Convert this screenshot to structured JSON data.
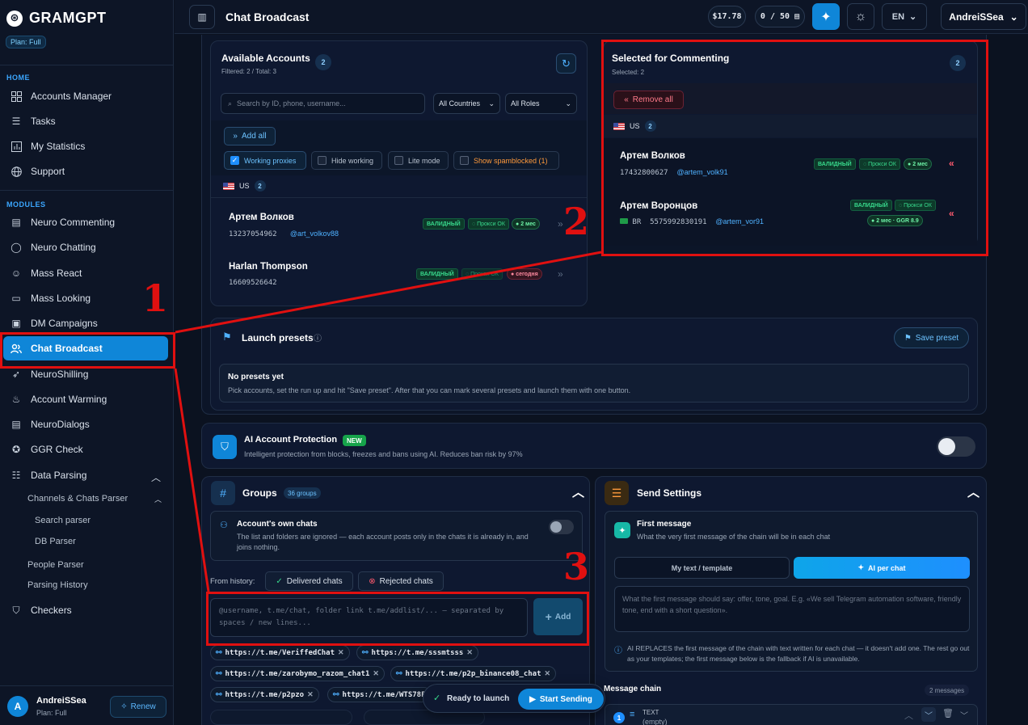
{
  "app": {
    "name": "GRAMGPT",
    "plan": "Plan: Full"
  },
  "sidebar": {
    "home_label": "HOME",
    "home_items": [
      {
        "label": "Accounts Manager",
        "icon": "grid-icon"
      },
      {
        "label": "Tasks",
        "icon": "list-icon"
      },
      {
        "label": "My Statistics",
        "icon": "bar-chart-icon"
      },
      {
        "label": "Support",
        "icon": "globe-icon"
      }
    ],
    "modules_label": "MODULES",
    "module_items": [
      {
        "label": "Neuro Commenting"
      },
      {
        "label": "Neuro Chatting"
      },
      {
        "label": "Mass React"
      },
      {
        "label": "Mass Looking"
      },
      {
        "label": "DM Campaigns"
      },
      {
        "label": "Chat Broadcast",
        "active": true
      },
      {
        "label": "NeuroShilling"
      },
      {
        "label": "Account Warming"
      },
      {
        "label": "NeuroDialogs"
      },
      {
        "label": "GGR Check"
      },
      {
        "label": "Data Parsing"
      }
    ],
    "sub_items": {
      "channels": "Channels & Chats Parser",
      "search": "Search parser",
      "db": "DB Parser",
      "people": "People Parser",
      "history": "Parsing History"
    },
    "checkers": "Checkers",
    "user": {
      "initial": "A",
      "name": "AndreiSSea",
      "plan": "Plan: Full",
      "renew": "Renew"
    }
  },
  "topbar": {
    "title": "Chat Broadcast",
    "balance": "$17.78",
    "quota": "0 / 50",
    "lang": "EN",
    "user": "AndreiSSea"
  },
  "available": {
    "title": "Available Accounts",
    "subtitle": "Filtered: 2 / Total: 3",
    "count": "2",
    "search_placeholder": "Search by ID, phone, username...",
    "country_select": "All Countries",
    "role_select": "All Roles",
    "add_all": "Add all",
    "toggles": {
      "working_proxies": "Working proxies",
      "hide_working": "Hide working",
      "lite_mode": "Lite mode",
      "show_spamblocked": "Show spamblocked (1)"
    },
    "group_country": "US",
    "group_count": "2",
    "accounts": [
      {
        "name": "Артем Волков",
        "id": "13237054962",
        "username": "@art_volkov88",
        "status": "ВАЛИДНЫЙ",
        "proxy": "Прокси ОК",
        "age": "2 мес"
      },
      {
        "name": "Harlan Thompson",
        "id": "16609526642",
        "status": "ВАЛИДНЫЙ",
        "proxy": "Прокси ОК",
        "age": "сегодня"
      }
    ]
  },
  "selected": {
    "title": "Selected for Commenting",
    "subtitle": "Selected: 2",
    "count": "2",
    "remove_all": "Remove all",
    "group_country": "US",
    "group_count": "2",
    "accounts": [
      {
        "name": "Артем Волков",
        "id": "17432800627",
        "username": "@artem_volk91",
        "status": "ВАЛИДНЫЙ",
        "proxy": "Прокси ОК",
        "age": "2 мес"
      },
      {
        "name": "Артем Воронцов",
        "country": "BR",
        "id": "5575992830191",
        "username": "@artem_vor91",
        "status": "ВАЛИДНЫЙ",
        "proxy": "Прокси ОК",
        "age": "2 мес",
        "ggr": "GGR 8.9"
      }
    ]
  },
  "presets": {
    "title": "Launch presets",
    "save": "Save preset",
    "empty_title": "No presets yet",
    "empty_text": "Pick accounts, set the run up and hit \"Save preset\". After that you can mark several presets and launch them with one button."
  },
  "protection": {
    "title": "AI Account Protection",
    "badge": "NEW",
    "desc": "Intelligent protection from blocks, freezes and bans using AI. Reduces ban risk by 97%"
  },
  "groups": {
    "title": "Groups",
    "badge": "36 groups",
    "own_title": "Account's own chats",
    "own_desc": "The list and folders are ignored — each account posts only in the chats it is already in, and joins nothing.",
    "history_label": "From history:",
    "delivered": "Delivered chats",
    "rejected": "Rejected chats",
    "input_placeholder": "@username, t.me/chat, folder link t.me/addlist/... — separated by spaces / new lines...",
    "add": "Add",
    "links": [
      "https://t.me/VeriffedChat",
      "https://t.me/sssmtsss",
      "https://t.me/zarobymo_razom_chat1",
      "https://t.me/p2p_binance08_chat",
      "https://t.me/p2pzo",
      "https://t.me/WTS78F"
    ]
  },
  "send": {
    "title": "Send Settings",
    "first_title": "First message",
    "first_desc": "What the very first message of the chain will be in each chat",
    "tab_text": "My text / template",
    "tab_ai": "AI per chat",
    "textarea_placeholder": "What the first message should say: offer, tone, goal. E.g. «We sell Telegram automation software, friendly tone, end with a short question».",
    "info": "AI REPLACES the first message of the chain with text written for each chat — it doesn't add one. The rest go out as your templates; the first message below is the fallback if AI is unavailable.",
    "chain_title": "Message chain",
    "chain_count": "2 messages",
    "item_num": "1",
    "item_type": "TEXT",
    "item_value": "(empty)"
  },
  "launch": {
    "ready": "Ready to launch",
    "start": "Start Sending"
  },
  "annotations": [
    "1",
    "2",
    "3"
  ],
  "colors": {
    "accent": "#0f86d8",
    "annotation": "#e01010",
    "valid": "#38d98c",
    "danger": "#ff5a6e"
  }
}
